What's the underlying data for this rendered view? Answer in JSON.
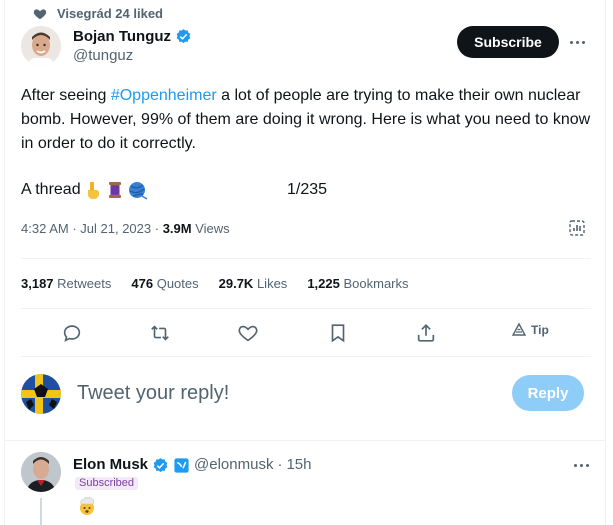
{
  "social_context": {
    "text": "Visegrád 24 liked",
    "icon": "heart-icon"
  },
  "author": {
    "name": "Bojan Tunguz",
    "handle": "@tunguz",
    "verified": true
  },
  "header": {
    "subscribe_label": "Subscribe"
  },
  "tweet": {
    "text_before_hashtag": "After seeing ",
    "hashtag": "#Oppenheimer",
    "text_after_hashtag": " a lot of people are trying to make their own nuclear bomb. However, 99% of them are doing it wrong. Here is what you need to know in order to do it correctly.",
    "thread_label": "A thread",
    "thread_emojis": [
      "pointing-down-emoji",
      "thread-spool-emoji",
      "yarn-ball-emoji"
    ],
    "thread_count": "1/235",
    "time": "4:32 AM",
    "date": "Jul 21, 2023",
    "views_count": "3.9M",
    "views_label": "Views"
  },
  "stats": [
    {
      "count": "3,187",
      "label": "Retweets"
    },
    {
      "count": "476",
      "label": "Quotes"
    },
    {
      "count": "29.7K",
      "label": "Likes"
    },
    {
      "count": "1,225",
      "label": "Bookmarks"
    }
  ],
  "actions": [
    "reply-icon",
    "retweet-icon",
    "like-icon",
    "bookmark-icon",
    "share-icon"
  ],
  "tip_label": "Tip",
  "composer": {
    "placeholder": "Tweet your reply!",
    "reply_label": "Reply"
  },
  "reply": {
    "name": "Elon Musk",
    "handle": "@elonmusk",
    "separator": "·",
    "time": "15h",
    "badge": "Subscribed",
    "content_emoji": "exploding-head-emoji"
  },
  "colors": {
    "accent": "#1d9bf0",
    "text": "#0f1419",
    "muted": "#536471",
    "reply_disabled": "#8ecdf7",
    "subscribe_bg": "#0f1419"
  }
}
